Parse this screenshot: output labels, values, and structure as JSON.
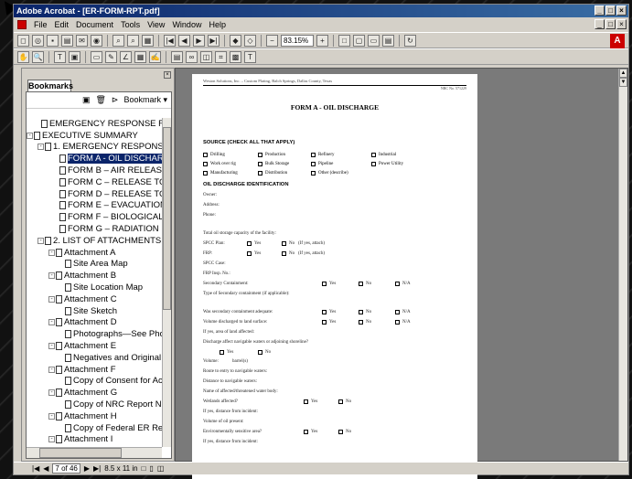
{
  "window": {
    "title": "Adobe Acrobat - [ER-FORM-RPT.pdf]"
  },
  "menu": [
    "File",
    "Edit",
    "Document",
    "Tools",
    "View",
    "Window",
    "Help"
  ],
  "toolbar": {
    "zoom": "83.15%"
  },
  "bookmarks": {
    "tab_label": "Bookmarks",
    "menu_label": "Bookmark ▾",
    "items": [
      {
        "label": "EMERGENCY RESPONSE REP",
        "toggle": ""
      },
      {
        "label": "EXECUTIVE SUMMARY",
        "toggle": "-"
      },
      {
        "label": "1. EMERGENCY RESPONSE",
        "toggle": "-"
      },
      {
        "label": "FORM A - OIL DISCHARG",
        "toggle": ""
      },
      {
        "label": "FORM B – AIR RELEASE",
        "toggle": ""
      },
      {
        "label": "FORM C – RELEASE TO",
        "toggle": ""
      },
      {
        "label": "FORM D – RELEASE TO",
        "toggle": ""
      },
      {
        "label": "FORM E – EVACUATION/",
        "toggle": ""
      },
      {
        "label": "FORM F – BIOLOGICAL/M",
        "toggle": ""
      },
      {
        "label": "FORM G – RADIATION RE",
        "toggle": ""
      },
      {
        "label": "2. LIST OF ATTACHMENTS",
        "toggle": "-"
      },
      {
        "label": "Attachment A",
        "toggle": "-"
      },
      {
        "label": "Site Area Map",
        "toggle": ""
      },
      {
        "label": "Attachment B",
        "toggle": "-"
      },
      {
        "label": "Site Location Map",
        "toggle": ""
      },
      {
        "label": "Attachment C",
        "toggle": "-"
      },
      {
        "label": "Site Sketch",
        "toggle": ""
      },
      {
        "label": "Attachment D",
        "toggle": "-"
      },
      {
        "label": "Photographs—See Pho",
        "toggle": ""
      },
      {
        "label": "Attachment E",
        "toggle": "-"
      },
      {
        "label": "Negatives and Original",
        "toggle": ""
      },
      {
        "label": "Attachment F",
        "toggle": "-"
      },
      {
        "label": "Copy of Consent for Ac",
        "toggle": ""
      },
      {
        "label": "Attachment G",
        "toggle": "-"
      },
      {
        "label": "Copy of NRC Report No",
        "toggle": ""
      },
      {
        "label": "Attachment H",
        "toggle": "-"
      },
      {
        "label": "Copy of Federal ER Re",
        "toggle": ""
      },
      {
        "label": "Attachment I",
        "toggle": "-"
      }
    ]
  },
  "document": {
    "header": "Weston Solutions, Inc. – Custom Plating, Balch Springs, Dallas County, Texas",
    "nrc": "NRC No. 571229",
    "title": "FORM A - OIL DISCHARGE",
    "source_heading": "SOURCE (CHECK ALL THAT APPLY)",
    "source_row1": [
      "Drilling",
      "Production",
      "Refinery",
      "Industrial"
    ],
    "source_row2": [
      "Work over rig",
      "Bulk Storage",
      "Pipeline",
      "Power Utility"
    ],
    "source_row3": [
      "Manufacturing",
      "Distribution",
      "Other (describe)"
    ],
    "id_heading": "OIL DISCHARGE IDENTIFICATION",
    "lines": [
      "Owner:",
      "Address:",
      "Phone:",
      "Total oil storage capacity of the facility:",
      "SPCC Plan:",
      "FRP:",
      "SPCC Case:",
      "FRP Insp. No.:",
      "Secondary Containment:",
      "Type of Secondary containment (if applicable):",
      "Was secondary containment adequate:",
      "Volume discharged to land surface:",
      "If yes, area of land affected:",
      "Discharge affect navigable waters or adjoining shoreline?",
      "Volume:",
      "Route to entry to navigable waters:",
      "Distance to navigable waters:",
      "Name of affected/threatened water body:",
      "Wetlands affected?",
      "If yes, distance from incident:",
      "Volume of oil present:",
      "Environmentally sensitive area?",
      "If yes, distance from incident:"
    ],
    "yes": "Yes",
    "no": "No",
    "na": "N/A",
    "if_yes_attach": "(If yes, attach)",
    "barrels": "barrel(s)"
  },
  "status": {
    "page_of": "7 of 46",
    "page_size": "8.5 x 11 in"
  }
}
